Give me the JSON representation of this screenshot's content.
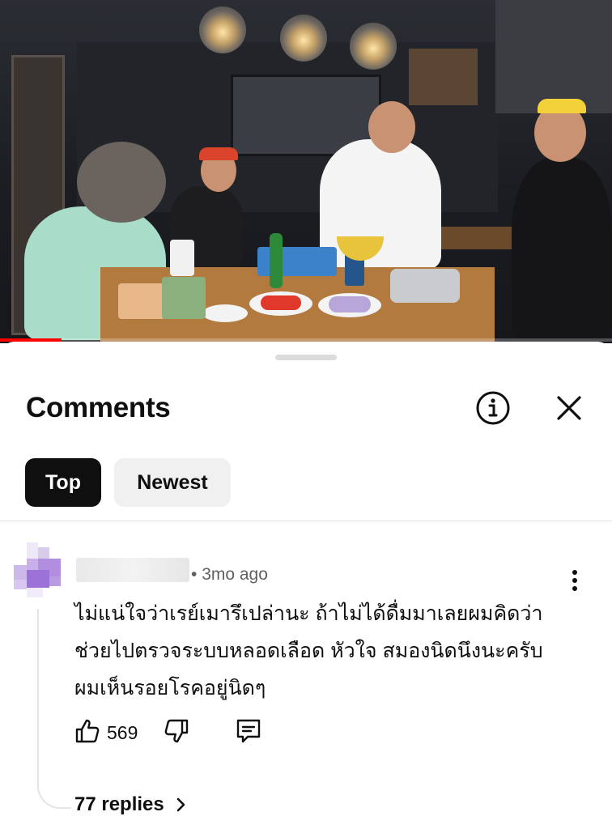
{
  "video": {
    "progress": 0.1
  },
  "sheet": {
    "title": "Comments",
    "info_icon": "info-icon",
    "close_icon": "close-icon",
    "tabs": [
      {
        "label": "Top",
        "selected": true
      },
      {
        "label": "Newest",
        "selected": false
      }
    ]
  },
  "comment": {
    "time": "3mo ago",
    "text_lines": [
      "ไม่แน่ใจว่าเรย์เมารึเปล่านะ ถ้าไม่ได้ดื่มมาเลยผมคิดว่า",
      "ช่วยไปตรวจระบบหลอดเลือด หัวใจ สมองนิดนึงนะครับ",
      "ผมเห็นรอยโรคอยู่นิดๆ"
    ],
    "likes": "569",
    "replies_label": "77 replies"
  },
  "colors": {
    "accent": "#0f0f0f",
    "progress": "#ff0000",
    "avatar": "#b48ee0"
  }
}
